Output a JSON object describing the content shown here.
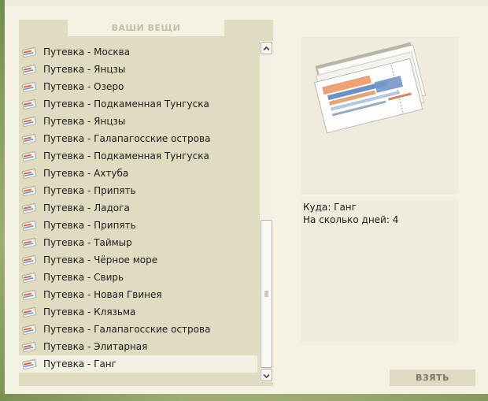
{
  "inventory": {
    "title": "ВАШИ ВЕЩИ",
    "items": [
      {
        "label": "Путевка - Москва"
      },
      {
        "label": "Путевка - Янцзы"
      },
      {
        "label": "Путевка - Озеро"
      },
      {
        "label": "Путевка - Подкаменная Тунгуска"
      },
      {
        "label": "Путевка - Янцзы"
      },
      {
        "label": "Путевка - Галапагосские острова"
      },
      {
        "label": "Путевка - Подкаменная Тунгуска"
      },
      {
        "label": "Путевка - Ахтуба"
      },
      {
        "label": "Путевка - Припять"
      },
      {
        "label": "Путевка - Ладога"
      },
      {
        "label": "Путевка - Припять"
      },
      {
        "label": "Путевка - Таймыр"
      },
      {
        "label": "Путевка - Чёрное море"
      },
      {
        "label": "Путевка - Свирь"
      },
      {
        "label": "Путевка - Новая Гвинея"
      },
      {
        "label": "Путевка - Клязьма"
      },
      {
        "label": "Путевка - Галапагосские острова"
      },
      {
        "label": "Путевка - Элитарная"
      },
      {
        "label": "Путевка - Ганг",
        "selected": true
      }
    ],
    "item_icon": "ticket-icon"
  },
  "scrollbar": {
    "up_icon": "chevron-up-icon",
    "down_icon": "chevron-down-icon",
    "grip_icon": "grip-icon"
  },
  "details": {
    "preview_icon": "ticket-stack-image",
    "destination_line": "Куда: Ганг",
    "days_line": "На сколько дней: 4"
  },
  "actions": {
    "take_label": "ВЗЯТЬ"
  },
  "colors": {
    "panel_bg": "#e0dcc2",
    "page_bg": "#f4f2e3",
    "selected_bg": "#f2f0e4",
    "title_text": "#c3bfa5"
  }
}
